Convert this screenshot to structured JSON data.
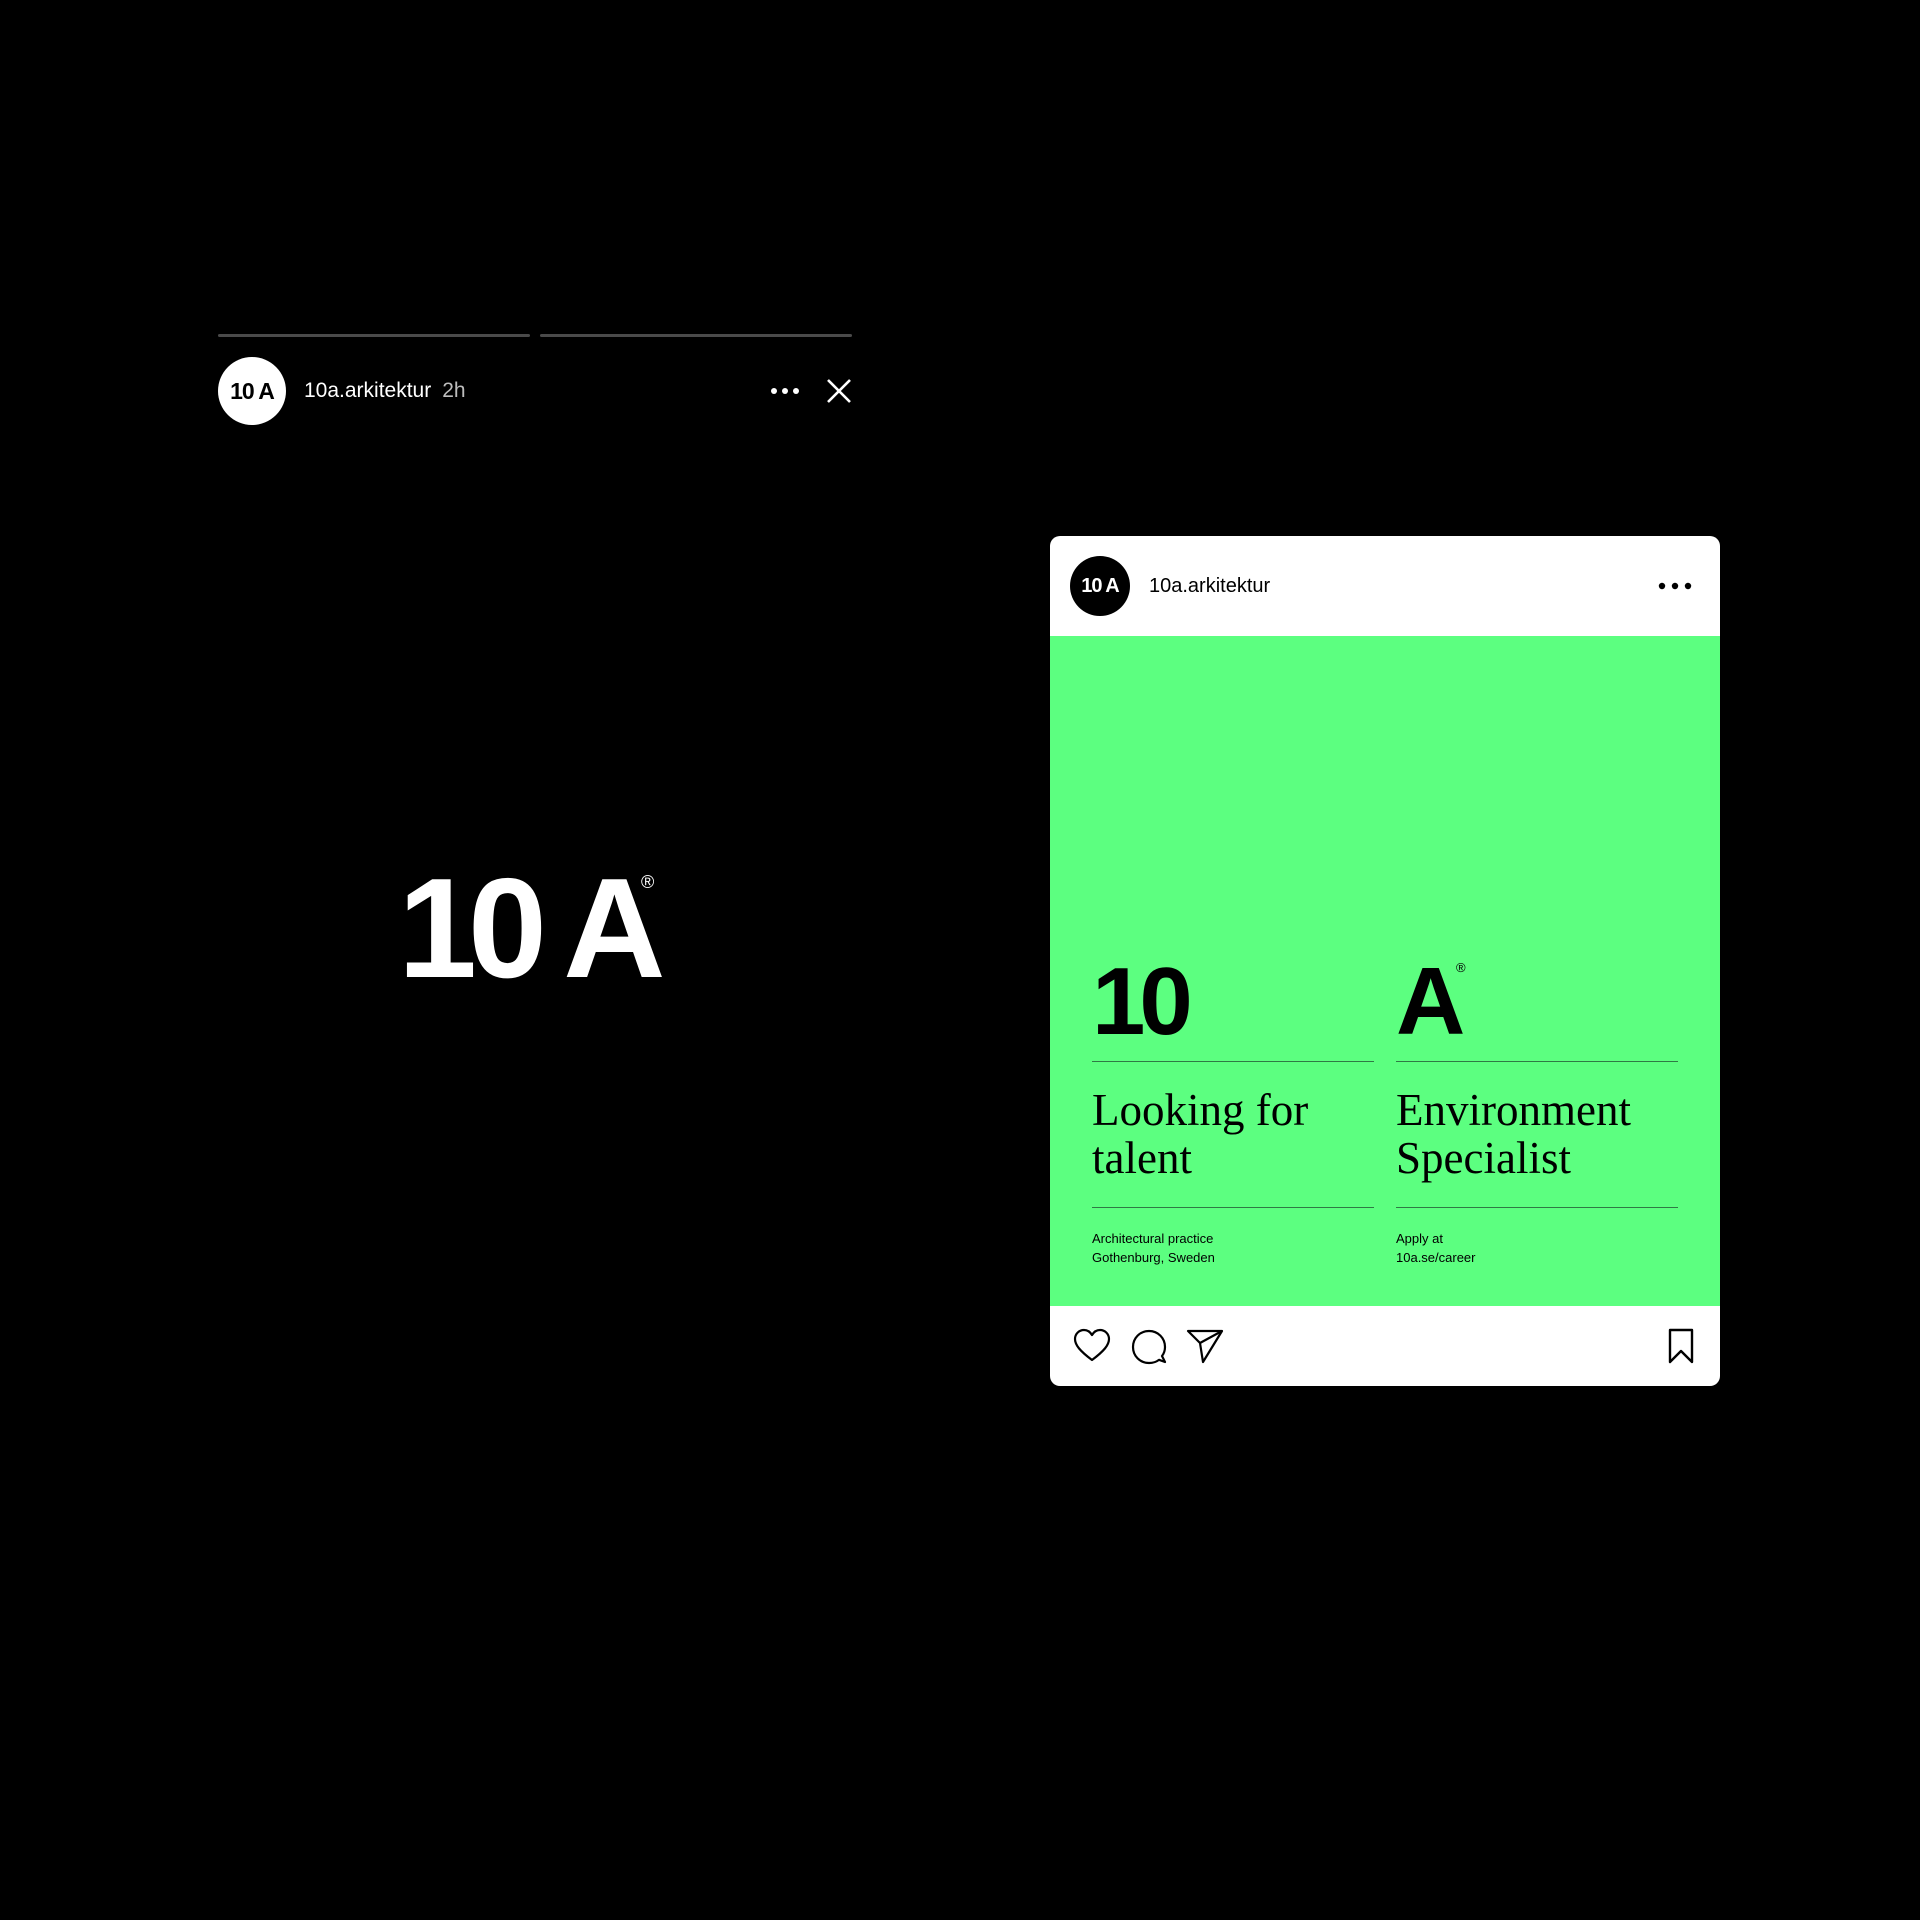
{
  "story": {
    "progress_segments": 2,
    "avatar_text": "10 A",
    "username": "10a.arkitektur",
    "time": "2h",
    "logo_text": "10 A",
    "logo_reg": "®"
  },
  "post": {
    "avatar_text": "10 A",
    "username": "10a.arkitektur",
    "image": {
      "background_color": "#5cff80",
      "left_big": "10",
      "right_big": "A",
      "right_reg": "®",
      "left_headline": [
        "Looking for",
        "talent"
      ],
      "right_headline": [
        "Environment",
        "Specialist"
      ],
      "left_small": [
        "Architectural practice",
        "Gothenburg, Sweden"
      ],
      "right_small": [
        "Apply at",
        "10a.se/career"
      ]
    },
    "actions": {
      "like_icon": "heart-icon",
      "comment_icon": "comment-icon",
      "share_icon": "send-icon",
      "save_icon": "bookmark-icon"
    }
  },
  "colors": {
    "background": "#000000",
    "accent_green": "#5cff80",
    "progress_track": "#4a4a4a"
  }
}
